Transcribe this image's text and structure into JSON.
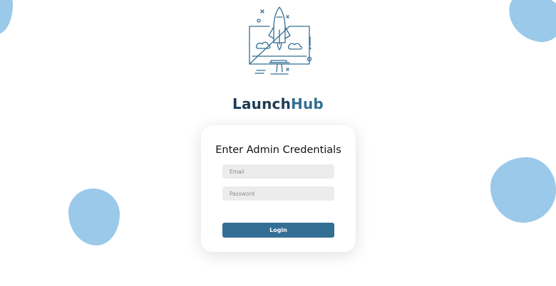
{
  "brand": {
    "name_part1": "Launch",
    "name_part2": "Hub"
  },
  "login_form": {
    "title": "Enter Admin Credentials",
    "email_placeholder": "Email",
    "password_placeholder": "Password",
    "login_label": "Login"
  },
  "icons": {
    "logo": "rocket-launching-from-monitor-icon"
  },
  "colors": {
    "primary": "#336f95",
    "brand_dark": "#1f3b52",
    "blob": "#9ac9ea",
    "input_bg": "#ececec"
  }
}
